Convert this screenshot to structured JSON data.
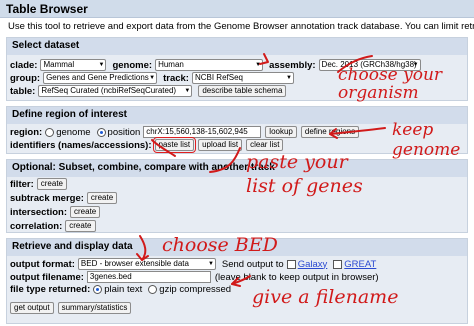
{
  "window": {
    "title": "Table Browser"
  },
  "intro": "Use this tool to retrieve and export data from the Genome Browser annotation track database. You can limit retrieval based",
  "select_dataset": {
    "heading": "Select dataset",
    "clade_label": "clade:",
    "clade_value": "Mammal",
    "genome_label": "genome:",
    "genome_value": "Human",
    "assembly_label": "assembly:",
    "assembly_value": "Dec. 2013 (GRCh38/hg38)",
    "group_label": "group:",
    "group_value": "Genes and Gene Predictions",
    "track_label": "track:",
    "track_value": "NCBI RefSeq",
    "table_label": "table:",
    "table_value": "RefSeq Curated (ncbiRefSeqCurated)",
    "describe_button": "describe table schema"
  },
  "region": {
    "heading": "Define region of interest",
    "region_label": "region:",
    "genome_option": "genome",
    "position_option": "position",
    "position_value": "chrX:15,560,138-15,602,945",
    "lookup_button": "lookup",
    "define_regions_button": "define regions",
    "identifiers_label": "identifiers (names/accessions):",
    "paste_list_button": "paste list",
    "upload_list_button": "upload list",
    "clear_list_button": "clear list"
  },
  "optional": {
    "heading": "Optional: Subset, combine, compare with another track",
    "filter_label": "filter:",
    "subtrack_label": "subtrack merge:",
    "intersection_label": "intersection:",
    "correlation_label": "correlation:",
    "create_button": "create"
  },
  "retrieve": {
    "heading": "Retrieve and display data",
    "output_format_label": "output format:",
    "output_format_value": "BED - browser extensible data",
    "send_output_label": "Send output to",
    "galaxy_link": "Galaxy",
    "great_link": "GREAT",
    "output_filename_label": "output filename:",
    "output_filename_value": "3genes.bed",
    "filename_hint": "(leave blank to keep output in browser)",
    "file_type_label": "file type returned:",
    "plain_text_option": "plain text",
    "gzip_option": "gzip compressed",
    "get_output_button": "get output",
    "summary_button": "summary/statistics"
  },
  "annotations": {
    "choose_organism": "choose your organism",
    "keep_genome": "keep genome",
    "paste_list": "paste your list of genes",
    "choose_bed": "choose BED",
    "give_filename": "give a filename",
    "color": "#d11a1a"
  }
}
